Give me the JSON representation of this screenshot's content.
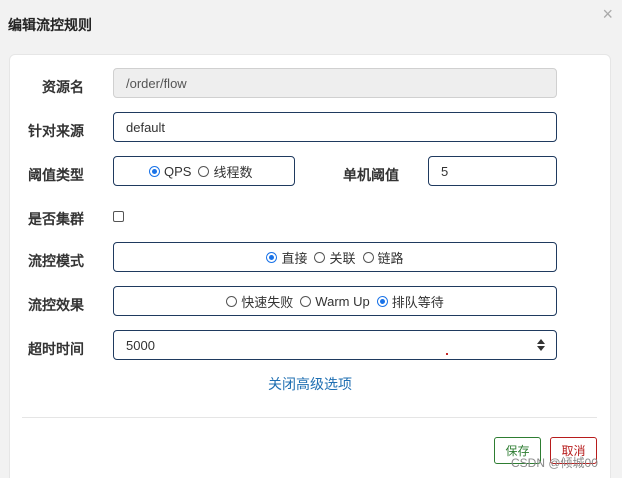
{
  "dialog": {
    "title": "编辑流控规则",
    "close_glyph": "×"
  },
  "form": {
    "resource": {
      "label": "资源名",
      "value": "/order/flow"
    },
    "limit_app": {
      "label": "针对来源",
      "value": "default"
    },
    "threshold_type": {
      "label": "阈值类型",
      "options": [
        "QPS",
        "线程数"
      ],
      "selected": "QPS"
    },
    "single_threshold": {
      "label": "单机阈值",
      "value": "5"
    },
    "cluster": {
      "label": "是否集群",
      "checked": false
    },
    "flow_mode": {
      "label": "流控模式",
      "options": [
        "直接",
        "关联",
        "链路"
      ],
      "selected": "直接"
    },
    "flow_effect": {
      "label": "流控效果",
      "options": [
        "快速失败",
        "Warm Up",
        "排队等待"
      ],
      "selected": "排队等待"
    },
    "timeout": {
      "label": "超时时间",
      "value": "5000"
    }
  },
  "advanced_toggle": "关闭高级选项",
  "buttons": {
    "save": "保存",
    "cancel": "取消"
  },
  "watermark": "CSDN @倾城00",
  "colors": {
    "accent": "#1a73e8",
    "save": "#2e7d32",
    "cancel": "#b71c1c",
    "link": "#1f6fb2"
  }
}
